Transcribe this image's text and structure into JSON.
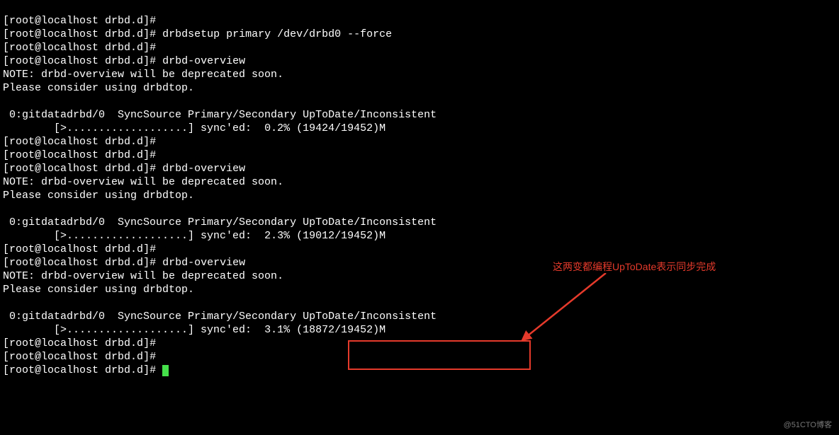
{
  "prompt_open": "[",
  "prompt_user": "root@localhost",
  "prompt_cwd": " drbd.d",
  "prompt_close": "]# ",
  "cmd_setup": "drbdsetup primary /dev/drbd0 --force",
  "cmd_overview": "drbd-overview",
  "note1": "NOTE: drbd-overview will be deprecated soon.",
  "note2": "Please consider using drbdtop.",
  "blank": "",
  "status_prefix": " 0:gitdatadrbd/0  SyncSource Primary/Secondary ",
  "status_state": "UpToDate/Inconsistent",
  "sync_bar": "        [>...................] sync'ed:  ",
  "sync_pct1": "0.2%",
  "sync_size1": " (19424/19452)M",
  "sync_pct2": "2.3%",
  "sync_size2": " (19012/19452)M",
  "sync_pct3": "3.1%",
  "sync_size3": " (18872/19452)M",
  "annotation_text": "这两变都编程UpToDate表示同步完成",
  "watermark": "@51CTO博客"
}
